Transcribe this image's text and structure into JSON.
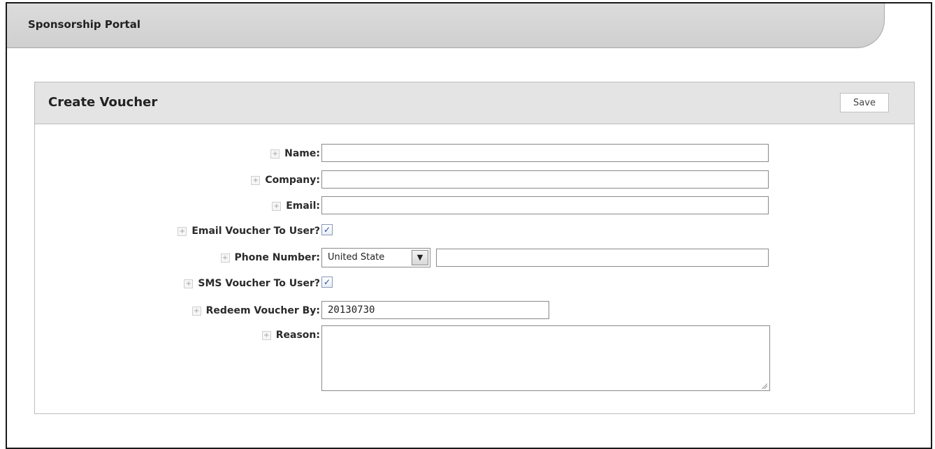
{
  "portal": {
    "title": "Sponsorship Portal"
  },
  "panel": {
    "title": "Create Voucher",
    "save_label": "Save"
  },
  "form": {
    "name": {
      "label": "Name:",
      "value": ""
    },
    "company": {
      "label": "Company:",
      "value": ""
    },
    "email": {
      "label": "Email:",
      "value": ""
    },
    "email_voucher": {
      "label": "Email Voucher To User?",
      "checked": true
    },
    "phone": {
      "label": "Phone Number:",
      "country": "United State",
      "value": ""
    },
    "sms_voucher": {
      "label": "SMS Voucher To User?",
      "checked": true
    },
    "redeem_by": {
      "label": "Redeem Voucher By:",
      "value": "20130730"
    },
    "reason": {
      "label": "Reason:",
      "value": ""
    }
  },
  "icons": {
    "expand": "plus-icon",
    "check": "check-icon",
    "dropdown": "chevron-down-icon"
  },
  "glyphs": {
    "plus": "+",
    "check": "✓",
    "arrow": "▼"
  }
}
